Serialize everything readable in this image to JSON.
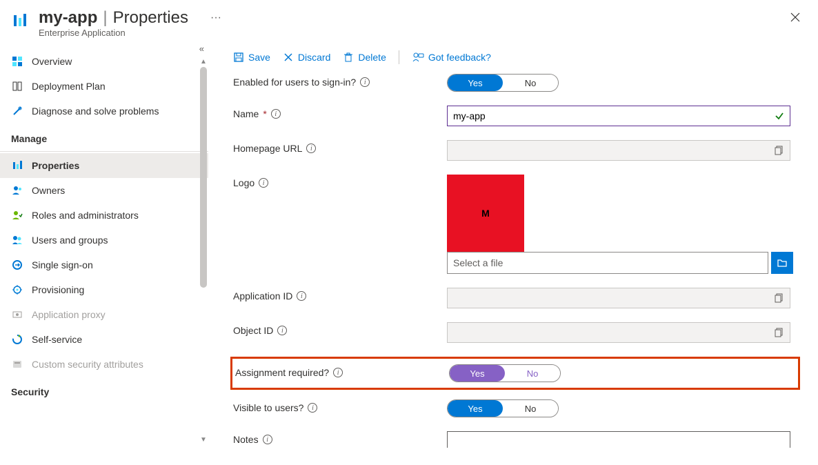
{
  "header": {
    "app_name": "my-app",
    "page_name": "Properties",
    "subtitle": "Enterprise Application"
  },
  "toolbar": {
    "save": "Save",
    "discard": "Discard",
    "delete": "Delete",
    "feedback": "Got feedback?"
  },
  "sidebar": {
    "items_top": [
      {
        "label": "Overview"
      },
      {
        "label": "Deployment Plan"
      },
      {
        "label": "Diagnose and solve problems"
      }
    ],
    "group_manage": "Manage",
    "items_manage": [
      {
        "label": "Properties",
        "active": true
      },
      {
        "label": "Owners"
      },
      {
        "label": "Roles and administrators"
      },
      {
        "label": "Users and groups"
      },
      {
        "label": "Single sign-on"
      },
      {
        "label": "Provisioning"
      },
      {
        "label": "Application proxy",
        "disabled": true
      },
      {
        "label": "Self-service"
      },
      {
        "label": "Custom security attributes",
        "disabled": true
      }
    ],
    "group_security": "Security"
  },
  "form": {
    "enabled_signin": {
      "label": "Enabled for users to sign-in?",
      "yes": "Yes",
      "no": "No",
      "value": "Yes"
    },
    "name": {
      "label": "Name",
      "value": "my-app",
      "required": true
    },
    "homepage": {
      "label": "Homepage URL",
      "value": ""
    },
    "logo": {
      "label": "Logo",
      "initial": "M",
      "file_placeholder": "Select a file"
    },
    "application_id": {
      "label": "Application ID",
      "value": ""
    },
    "object_id": {
      "label": "Object ID",
      "value": ""
    },
    "assignment_required": {
      "label": "Assignment required?",
      "yes": "Yes",
      "no": "No",
      "value": "Yes"
    },
    "visible": {
      "label": "Visible to users?",
      "yes": "Yes",
      "no": "No",
      "value": "Yes"
    },
    "notes": {
      "label": "Notes"
    }
  }
}
